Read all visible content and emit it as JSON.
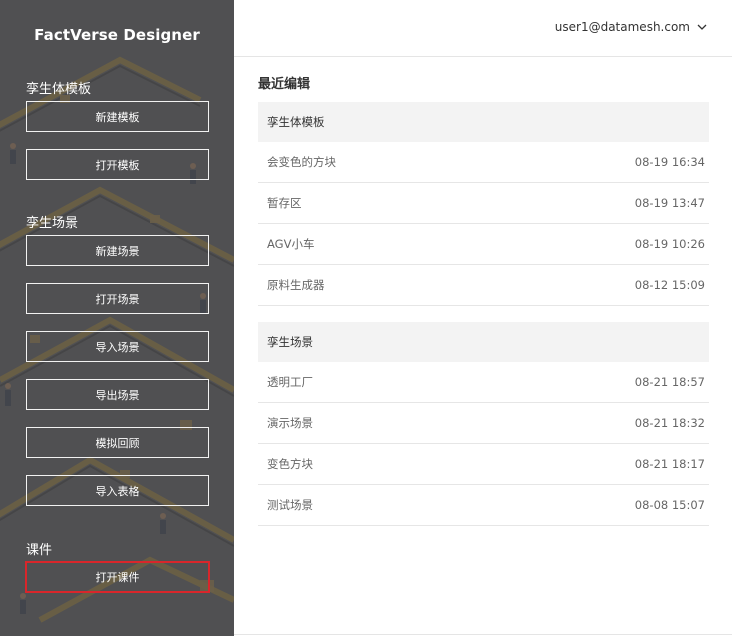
{
  "app": {
    "title": "FactVerse Designer"
  },
  "sidebar": {
    "sections": [
      {
        "title": "孪生体模板",
        "buttons": [
          "新建模板",
          "打开模板"
        ]
      },
      {
        "title": "孪生场景",
        "buttons": [
          "新建场景",
          "打开场景",
          "导入场景",
          "导出场景",
          "模拟回顾",
          "导入表格"
        ]
      },
      {
        "title": "课件",
        "buttons": [
          "打开课件"
        ]
      }
    ]
  },
  "header": {
    "user_email": "user1@datamesh.com",
    "dropdown_icon": "chevron-down-icon"
  },
  "main": {
    "recent_title": "最近编辑",
    "groups": [
      {
        "title": "孪生体模板",
        "items": [
          {
            "name": "会变色的方块",
            "time": "08-19 16:34"
          },
          {
            "name": "暂存区",
            "time": "08-19 13:47"
          },
          {
            "name": "AGV小车",
            "time": "08-19 10:26"
          },
          {
            "name": "原料生成器",
            "time": "08-12 15:09"
          }
        ]
      },
      {
        "title": "孪生场景",
        "items": [
          {
            "name": "透明工厂",
            "time": "08-21 18:57"
          },
          {
            "name": "演示场景",
            "time": "08-21 18:32"
          },
          {
            "name": "变色方块",
            "time": "08-21 18:17"
          },
          {
            "name": "测试场景",
            "time": "08-08 15:07"
          }
        ]
      }
    ]
  },
  "colors": {
    "sidebar_bg": "#5b5c5e",
    "highlight_border": "#d9262b",
    "group_header_bg": "#f3f3f3",
    "text_primary": "#333333",
    "text_secondary": "#666666"
  }
}
